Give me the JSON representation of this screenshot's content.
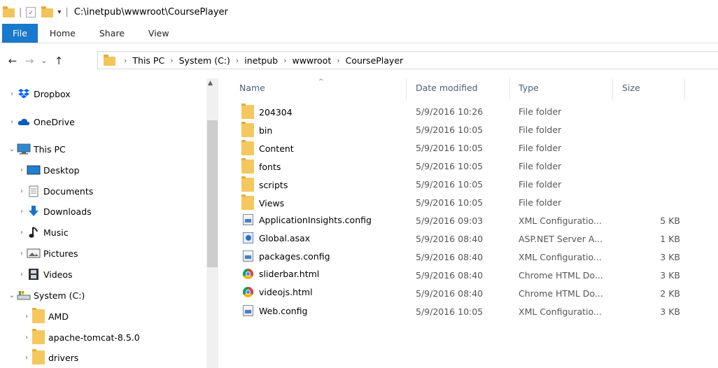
{
  "window": {
    "title": "C:\\inetpub\\wwwroot\\CoursePlayer",
    "separator": "|",
    "qa_dropdown": "▾"
  },
  "ribbon": {
    "tabs": [
      {
        "label": "File"
      },
      {
        "label": "Home"
      },
      {
        "label": "Share"
      },
      {
        "label": "View"
      }
    ]
  },
  "nav": {
    "back": "←",
    "forward": "→",
    "recent": "⌄",
    "up": "↑"
  },
  "breadcrumb": {
    "items": [
      "This PC",
      "System (C:)",
      "inetpub",
      "wwwroot",
      "CoursePlayer"
    ],
    "chevron": "›"
  },
  "navpane": {
    "items": [
      {
        "label": "Dropbox",
        "icon": "dropbox-icon"
      },
      {
        "label": "OneDrive",
        "icon": "onedrive-icon"
      },
      {
        "label": "This PC",
        "icon": "this-pc-icon",
        "expanded": true
      },
      {
        "label": "Desktop",
        "icon": "desktop-icon"
      },
      {
        "label": "Documents",
        "icon": "documents-icon"
      },
      {
        "label": "Downloads",
        "icon": "downloads-icon"
      },
      {
        "label": "Music",
        "icon": "music-icon"
      },
      {
        "label": "Pictures",
        "icon": "pictures-icon"
      },
      {
        "label": "Videos",
        "icon": "videos-icon"
      },
      {
        "label": "System (C:)",
        "icon": "drive-icon",
        "expanded": true
      },
      {
        "label": "AMD",
        "icon": "folder-icon"
      },
      {
        "label": "apache-tomcat-8.5.0",
        "icon": "folder-icon"
      },
      {
        "label": "drivers",
        "icon": "folder-icon"
      }
    ]
  },
  "columns": {
    "name": "Name",
    "date": "Date modified",
    "type": "Type",
    "size": "Size"
  },
  "files": [
    {
      "name": "204304",
      "date": "5/9/2016 10:26",
      "type": "File folder",
      "size": "",
      "icon": "folder-icon"
    },
    {
      "name": "bin",
      "date": "5/9/2016 10:05",
      "type": "File folder",
      "size": "",
      "icon": "folder-icon"
    },
    {
      "name": "Content",
      "date": "5/9/2016 10:05",
      "type": "File folder",
      "size": "",
      "icon": "folder-icon"
    },
    {
      "name": "fonts",
      "date": "5/9/2016 10:05",
      "type": "File folder",
      "size": "",
      "icon": "folder-icon"
    },
    {
      "name": "scripts",
      "date": "5/9/2016 10:05",
      "type": "File folder",
      "size": "",
      "icon": "folder-icon"
    },
    {
      "name": "Views",
      "date": "5/9/2016 10:05",
      "type": "File folder",
      "size": "",
      "icon": "folder-icon"
    },
    {
      "name": "ApplicationInsights.config",
      "date": "5/9/2016 09:03",
      "type": "XML Configuratio...",
      "size": "5 KB",
      "icon": "xml-config-icon"
    },
    {
      "name": "Global.asax",
      "date": "5/9/2016 08:40",
      "type": "ASP.NET Server A...",
      "size": "1 KB",
      "icon": "aspnet-icon"
    },
    {
      "name": "packages.config",
      "date": "5/9/2016 08:40",
      "type": "XML Configuratio...",
      "size": "3 KB",
      "icon": "xml-config-icon"
    },
    {
      "name": "sliderbar.html",
      "date": "5/9/2016 08:40",
      "type": "Chrome HTML Do...",
      "size": "3 KB",
      "icon": "chrome-html-icon"
    },
    {
      "name": "videojs.html",
      "date": "5/9/2016 08:40",
      "type": "Chrome HTML Do...",
      "size": "2 KB",
      "icon": "chrome-html-icon"
    },
    {
      "name": "Web.config",
      "date": "5/9/2016 10:05",
      "type": "XML Configuratio...",
      "size": "3 KB",
      "icon": "xml-config-icon"
    }
  ]
}
